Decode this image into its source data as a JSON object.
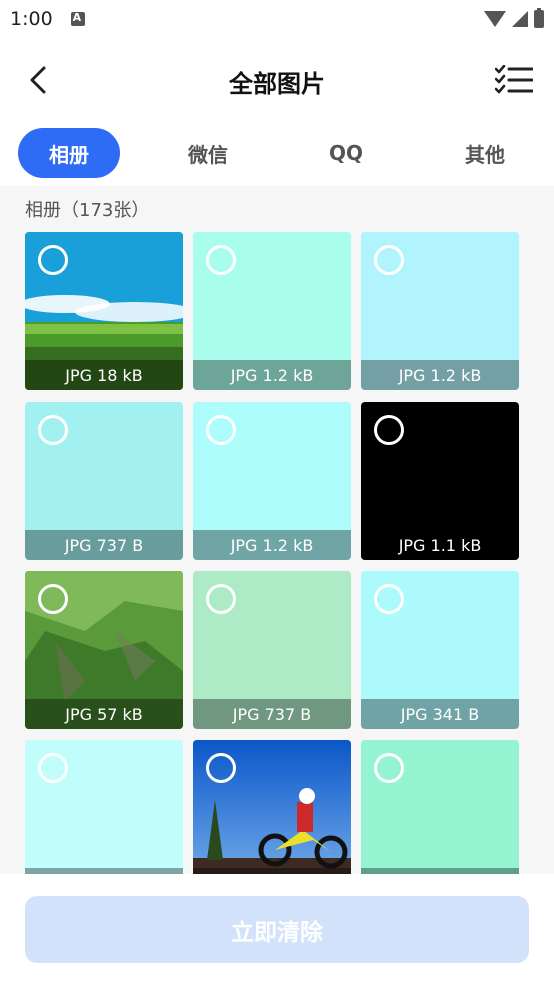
{
  "status_bar": {
    "time": "1:00"
  },
  "header": {
    "title": "全部图片"
  },
  "tabs": [
    {
      "label": "相册",
      "active": true
    },
    {
      "label": "微信",
      "active": false
    },
    {
      "label": "QQ",
      "active": false
    },
    {
      "label": "其他",
      "active": false
    }
  ],
  "album": {
    "count_label": "相册（173张）"
  },
  "photos": [
    {
      "caption": "JPG 18 kB",
      "bg": "#1aa0d8",
      "kind": "landscape"
    },
    {
      "caption": "JPG 1.2 kB",
      "bg": "#a8fdec",
      "kind": "solid"
    },
    {
      "caption": "JPG 1.2 kB",
      "bg": "#b2f4fd",
      "kind": "solid"
    },
    {
      "caption": "JPG 737 B",
      "bg": "#a2f0f0",
      "kind": "solid"
    },
    {
      "caption": "JPG 1.2 kB",
      "bg": "#adfdfd",
      "kind": "solid"
    },
    {
      "caption": "JPG 1.1 kB",
      "bg": "#000000",
      "kind": "solid"
    },
    {
      "caption": "JPG 57 kB",
      "bg": "#4a8a3a",
      "kind": "valley"
    },
    {
      "caption": "JPG 737 B",
      "bg": "#adeac6",
      "kind": "solid"
    },
    {
      "caption": "JPG 341 B",
      "bg": "#adfafd",
      "kind": "solid"
    },
    {
      "caption": "",
      "bg": "#c0fdfb",
      "kind": "solid"
    },
    {
      "caption": "",
      "bg": "#2a7ad8",
      "kind": "motocross"
    },
    {
      "caption": "",
      "bg": "#94f4d2",
      "kind": "solid"
    }
  ],
  "footer": {
    "clear_label": "立即清除"
  },
  "colors": {
    "accent": "#2f6cf6",
    "disabled_button": "#d2e2fb"
  },
  "icons": {
    "back": "chevron-left-icon",
    "menu": "checklist-icon"
  }
}
